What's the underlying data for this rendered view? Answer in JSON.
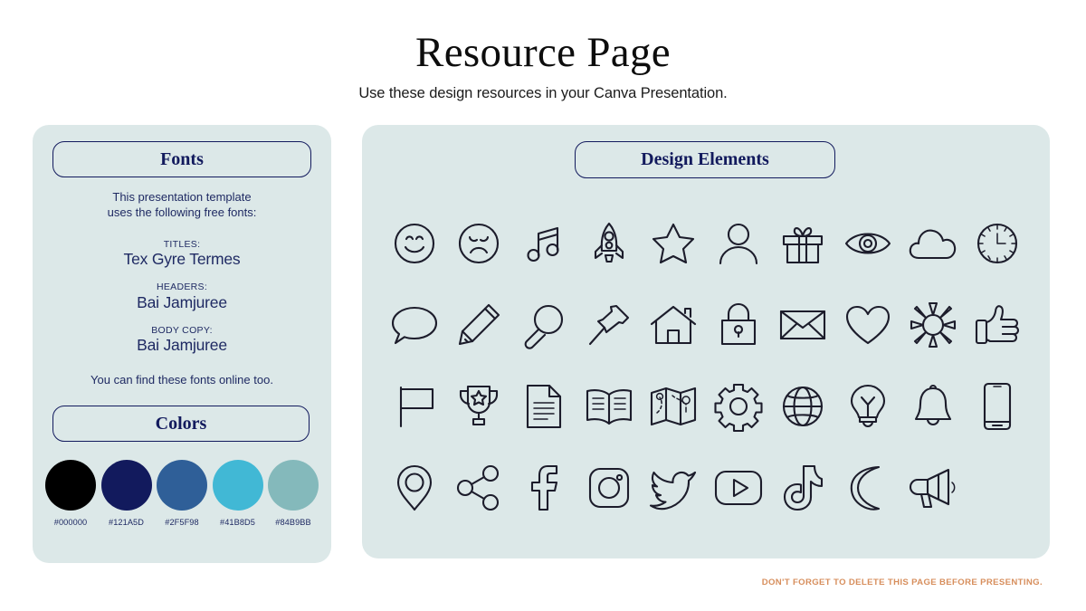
{
  "header": {
    "title": "Resource Page",
    "subtitle": "Use these design resources in your Canva Presentation."
  },
  "fonts_panel": {
    "heading": "Fonts",
    "intro_line_1": "This presentation template",
    "intro_line_2": "uses the following free fonts:",
    "entries": [
      {
        "label": "TITLES:",
        "name": "Tex Gyre Termes"
      },
      {
        "label": "HEADERS:",
        "name": "Bai Jamjuree"
      },
      {
        "label": "BODY COPY:",
        "name": "Bai Jamjuree"
      }
    ],
    "online_note": "You can find these fonts online too."
  },
  "colors_panel": {
    "heading": "Colors",
    "swatches": [
      {
        "hex_label": "#000000",
        "hex": "#000000"
      },
      {
        "hex_label": "#121A5D",
        "hex": "#121A5D"
      },
      {
        "hex_label": "#2F5F98",
        "hex": "#2F5F98"
      },
      {
        "hex_label": "#41B8D5",
        "hex": "#41B8D5"
      },
      {
        "hex_label": "#84B9BB",
        "hex": "#84B9BB"
      }
    ]
  },
  "elements_panel": {
    "heading": "Design Elements",
    "icons": [
      "smiley-face-icon",
      "sad-face-icon",
      "music-note-icon",
      "rocket-icon",
      "star-icon",
      "person-icon",
      "gift-icon",
      "eye-icon",
      "cloud-icon",
      "clock-icon",
      "speech-bubble-icon",
      "pencil-icon",
      "magnifying-glass-icon",
      "pushpin-icon",
      "house-icon",
      "lock-icon",
      "envelope-icon",
      "heart-icon",
      "sun-icon",
      "thumbs-up-icon",
      "flag-icon",
      "trophy-icon",
      "document-icon",
      "open-book-icon",
      "map-icon",
      "gear-icon",
      "globe-icon",
      "lightbulb-icon",
      "bell-icon",
      "smartphone-icon",
      "location-pin-icon",
      "share-icon",
      "facebook-icon",
      "instagram-icon",
      "twitter-icon",
      "youtube-icon",
      "tiktok-icon",
      "moon-icon",
      "megaphone-icon"
    ]
  },
  "footer": {
    "note": "DON'T FORGET TO DELETE THIS PAGE BEFORE PRESENTING.",
    "color": "#D78E5C"
  },
  "theme": {
    "panel_background": "#DCE8E8",
    "ink": "#121A5D",
    "icon_stroke": "#1C1C2B",
    "page_background": "#FFFFFF"
  }
}
